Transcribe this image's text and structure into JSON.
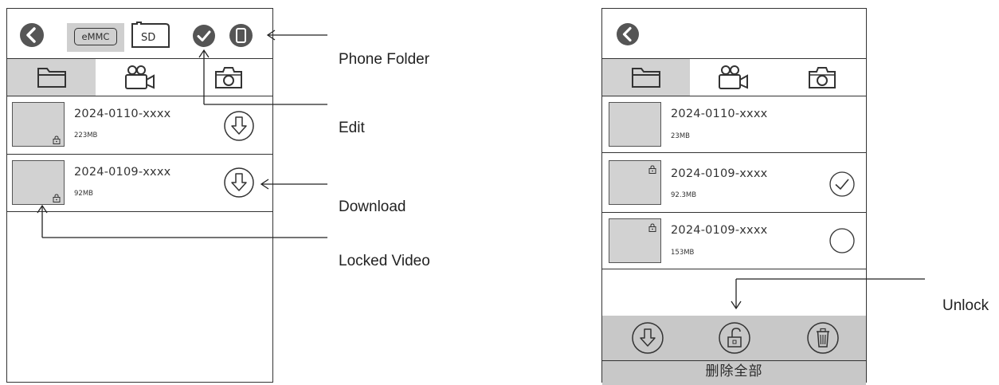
{
  "left_screen": {
    "storage_tabs": {
      "emmc": "eMMC",
      "sd": "SD"
    },
    "files": [
      {
        "name": "2024-0110-xxxx",
        "size": "223MB"
      },
      {
        "name": "2024-0109-xxxx",
        "size": "92MB"
      }
    ]
  },
  "right_screen": {
    "files": [
      {
        "name": "2024-0110-xxxx",
        "size": "23MB",
        "locked": false,
        "selected": null
      },
      {
        "name": "2024-0109-xxxx",
        "size": "92.3MB",
        "locked": true,
        "selected": true
      },
      {
        "name": "2024-0109-xxxx",
        "size": "153MB",
        "locked": true,
        "selected": false
      }
    ],
    "delete_all": "删除全部"
  },
  "annotations": {
    "phone_folder": "Phone Folder",
    "edit": "Edit",
    "download": "Download",
    "locked_video": "Locked Video",
    "unlock": "Unlock"
  },
  "icons": [
    "back-icon",
    "check-icon",
    "phone-icon",
    "folder-icon",
    "video-camera-icon",
    "photo-camera-icon",
    "download-icon",
    "lock-icon",
    "unlock-icon",
    "trash-icon",
    "radio-unchecked-icon",
    "radio-checked-icon"
  ],
  "colors": {
    "header_gray": "#d2d2d2",
    "icon_dark": "#555555",
    "line": "#333333"
  }
}
